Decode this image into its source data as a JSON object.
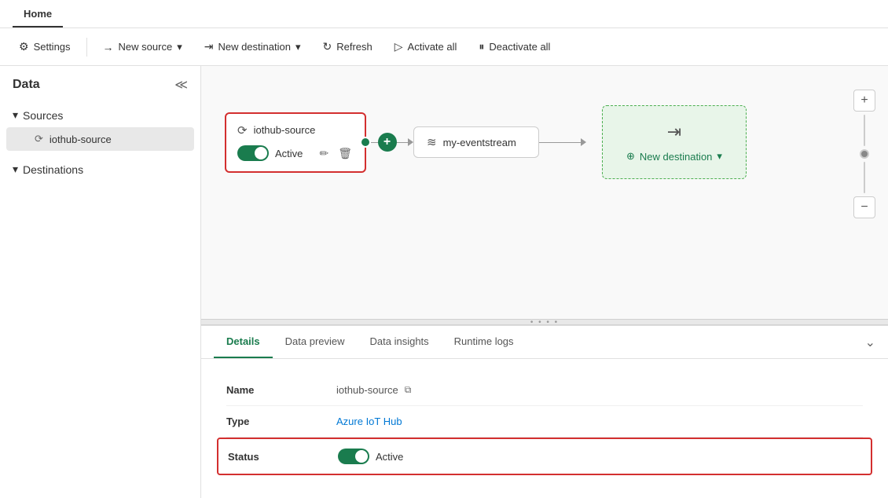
{
  "tabs": [
    {
      "id": "home",
      "label": "Home",
      "active": true
    }
  ],
  "toolbar": {
    "settings_label": "Settings",
    "new_source_label": "New source",
    "new_destination_label": "New destination",
    "refresh_label": "Refresh",
    "activate_all_label": "Activate all",
    "deactivate_all_label": "Deactivate all"
  },
  "sidebar": {
    "title": "Data",
    "sections": [
      {
        "id": "sources",
        "label": "Sources",
        "expanded": true,
        "items": [
          {
            "id": "iothub-source",
            "label": "iothub-source",
            "selected": true
          }
        ]
      },
      {
        "id": "destinations",
        "label": "Destinations",
        "expanded": false,
        "items": []
      }
    ]
  },
  "canvas": {
    "source_node": {
      "label": "iothub-source",
      "status": "Active"
    },
    "eventstream_node": {
      "label": "my-eventstream"
    },
    "destination_node": {
      "new_destination_label": "New destination"
    }
  },
  "details": {
    "tabs": [
      {
        "id": "details",
        "label": "Details",
        "active": true
      },
      {
        "id": "data-preview",
        "label": "Data preview",
        "active": false
      },
      {
        "id": "data-insights",
        "label": "Data insights",
        "active": false
      },
      {
        "id": "runtime-logs",
        "label": "Runtime logs",
        "active": false
      }
    ],
    "fields": [
      {
        "id": "name",
        "label": "Name",
        "value": "iothub-source",
        "type": "copy"
      },
      {
        "id": "type",
        "label": "Type",
        "value": "Azure IoT Hub",
        "type": "link"
      },
      {
        "id": "status",
        "label": "Status",
        "value": "Active",
        "type": "toggle",
        "highlighted": true
      }
    ]
  }
}
